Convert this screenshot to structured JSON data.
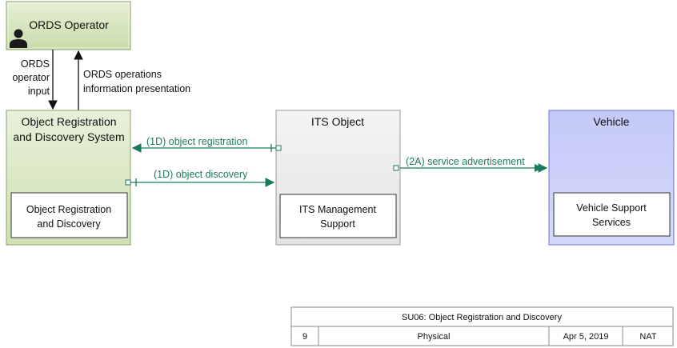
{
  "operator": {
    "title": "ORDS Operator"
  },
  "ords_system": {
    "title_line1": "Object Registration",
    "title_line2": "and Discovery System",
    "inner_line1": "Object Registration",
    "inner_line2": "and Discovery"
  },
  "its_object": {
    "title": "ITS Object",
    "inner_line1": "ITS Management",
    "inner_line2": "Support"
  },
  "vehicle": {
    "title": "Vehicle",
    "inner_line1": "Vehicle Support",
    "inner_line2": "Services"
  },
  "flows": {
    "operator_input_line1": "ORDS",
    "operator_input_line2": "operator",
    "operator_input_line3": "input",
    "ops_info_line1": "ORDS operations",
    "ops_info_line2": "information presentation",
    "object_registration": "(1D) object registration",
    "object_discovery": "(1D) object discovery",
    "service_advertisement": "(2A) service advertisement"
  },
  "title_block": {
    "diagram_title": "SU06: Object Registration and Discovery",
    "number": "9",
    "view": "Physical",
    "date": "Apr 5, 2019",
    "org": "NAT"
  },
  "colors": {
    "terminator_green": "#d8e8c0",
    "subsystem_green": "#dde9c7",
    "its_object_gray": "#eeeeee",
    "vehicle_blue": "#c8cdfa",
    "flow_green": "#1b7a5e"
  }
}
